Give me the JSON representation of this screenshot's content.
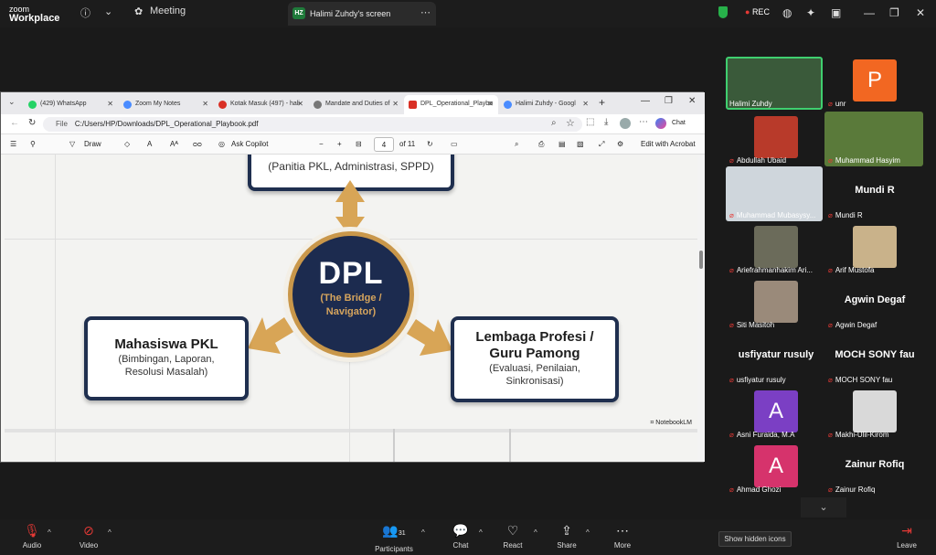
{
  "app": {
    "brand_line1": "zoom",
    "brand_line2": "Workplace",
    "meeting_label": "Meeting",
    "share_badge": "HZ",
    "share_title": "Halimi Zuhdy's screen",
    "rec_label": "REC"
  },
  "browser": {
    "tabs": [
      {
        "label": "(429) WhatsApp",
        "color": "#25d366"
      },
      {
        "label": "Zoom My Notes",
        "color": "#4a8cff"
      },
      {
        "label": "Kotak Masuk (497) - hali",
        "color": "#d93025"
      },
      {
        "label": "Mandate and Duties of",
        "color": "#777777"
      },
      {
        "label": "DPL_Operational_Playbo",
        "color": "#d93025"
      },
      {
        "label": "Halimi Zuhdy - Googl",
        "color": "#4a8cff"
      }
    ],
    "file_label": "File",
    "url": "C:/Users/HP/Downloads/DPL_Operational_Playbook.pdf",
    "chat_label": "Chat"
  },
  "pdf_toolbar": {
    "draw": "Draw",
    "copilot": "Ask Copilot",
    "minus": "−",
    "plus": "+",
    "page": "4",
    "of": "of 11",
    "edit": "Edit with Acrobat"
  },
  "diagram": {
    "top_sub": "(Panitia PKL, Administrasi, SPPD)",
    "center_title": "DPL",
    "center_sub1": "(The Bridge /",
    "center_sub2": "Navigator)",
    "left_title": "Mahasiswa PKL",
    "left_sub1": "(Bimbingan, Laporan,",
    "left_sub2": "Resolusi Masalah)",
    "right_title1": "Lembaga Profesi /",
    "right_title2": "Guru Pamong",
    "right_sub1": "(Evaluasi, Penilaian,",
    "right_sub2": "Sinkronisasi)",
    "watermark": "NotebookLM"
  },
  "participants": [
    {
      "name": "Halimi Zuhdy",
      "type": "photo",
      "color": "#3a5a3a"
    },
    {
      "name": "unr",
      "type": "letter",
      "letter": "P",
      "color": "#f26722"
    },
    {
      "name": "Abdullah Ubaid",
      "type": "photo",
      "color": "#b83a2a"
    },
    {
      "name": "Muhammad Hasyim",
      "type": "photo",
      "color": "#5a7a3a"
    },
    {
      "name": "Muhammad Mubasysy...",
      "type": "photo",
      "color": "#cfd6dc"
    },
    {
      "name": "Mundi R",
      "type": "text",
      "big": "Mundi R"
    },
    {
      "name": "Ariefrahmanhakim Ari...",
      "type": "photo",
      "color": "#6b6b5a"
    },
    {
      "name": "Arif Mustofa",
      "type": "photo",
      "color": "#c9b28a"
    },
    {
      "name": "Siti Masitoh",
      "type": "photo",
      "color": "#9a8a7a"
    },
    {
      "name": "Agwin Degaf",
      "type": "text",
      "big": "Agwin Degaf"
    },
    {
      "name": "usfiyatur rusuly",
      "type": "text",
      "big": "usfiyatur rusuly"
    },
    {
      "name": "MOCH SONY fau",
      "type": "text",
      "big": "MOCH SONY fau"
    },
    {
      "name": "Asni Furaida, M.A",
      "type": "letter",
      "letter": "A",
      "color": "#7b3fc4"
    },
    {
      "name": "Makhi-Ulil-Kirom",
      "type": "photo",
      "color": "#d9d9d9"
    },
    {
      "name": "Ahmad Ghozi",
      "type": "letter",
      "letter": "A",
      "color": "#d6336c"
    },
    {
      "name": "Zainur Rofiq",
      "type": "text",
      "big": "Zainur Rofiq"
    }
  ],
  "bottom": {
    "audio": "Audio",
    "video": "Video",
    "participants": "Participants",
    "count": "31",
    "chat": "Chat",
    "react": "React",
    "share": "Share",
    "more": "More",
    "leave": "Leave",
    "hidden_icons": "Show hidden icons"
  }
}
